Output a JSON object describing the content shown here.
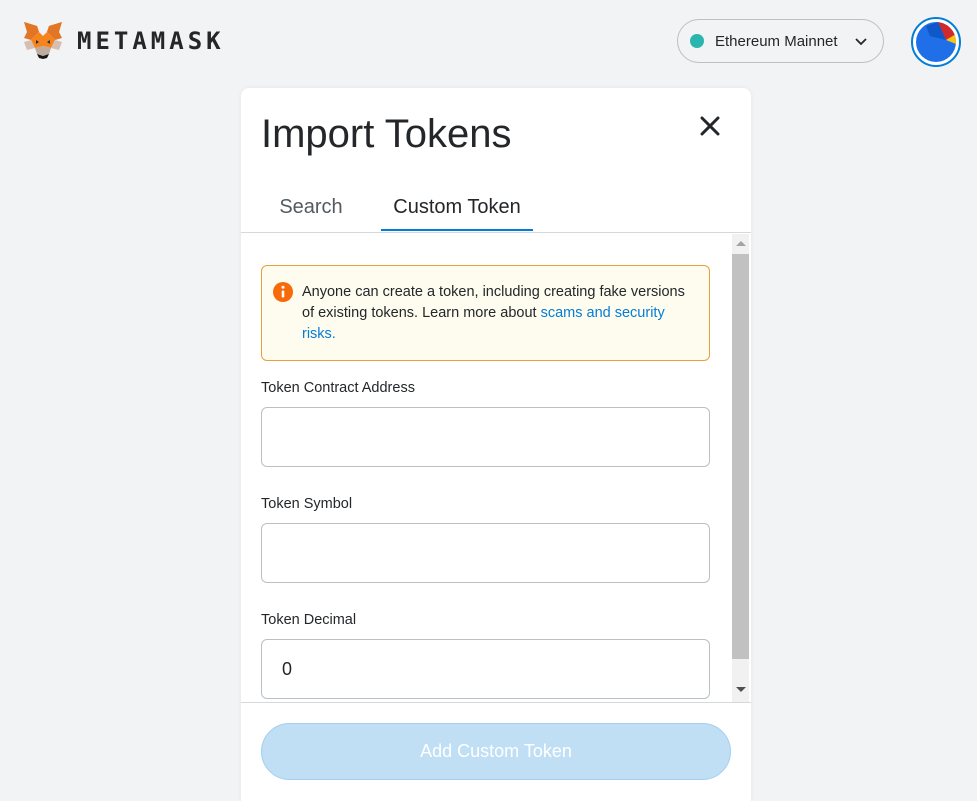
{
  "header": {
    "brand": "METAMASK",
    "network": {
      "name": "Ethereum Mainnet",
      "status_color": "#29b6af"
    },
    "icons": {
      "logo": "metamask-fox-icon",
      "network_chevron": "chevron-down-icon",
      "account": "account-identicon"
    }
  },
  "modal": {
    "title": "Import Tokens",
    "close_icon": "close-icon",
    "tabs": [
      {
        "label": "Search",
        "active": false
      },
      {
        "label": "Custom Token",
        "active": true
      }
    ],
    "warning": {
      "icon": "info-icon",
      "text": "Anyone can create a token, including creating fake versions of existing tokens. Learn more about ",
      "link_text": "scams and security risks."
    },
    "fields": {
      "contract_address": {
        "label": "Token Contract Address",
        "value": ""
      },
      "symbol": {
        "label": "Token Symbol",
        "value": ""
      },
      "decimal": {
        "label": "Token Decimal",
        "value": "0"
      }
    },
    "add_button": "Add Custom Token"
  },
  "colors": {
    "accent": "#037dd6",
    "warning_border": "#e8a03a",
    "warning_icon": "#f66a0a",
    "button_disabled": "#c0dff5"
  }
}
